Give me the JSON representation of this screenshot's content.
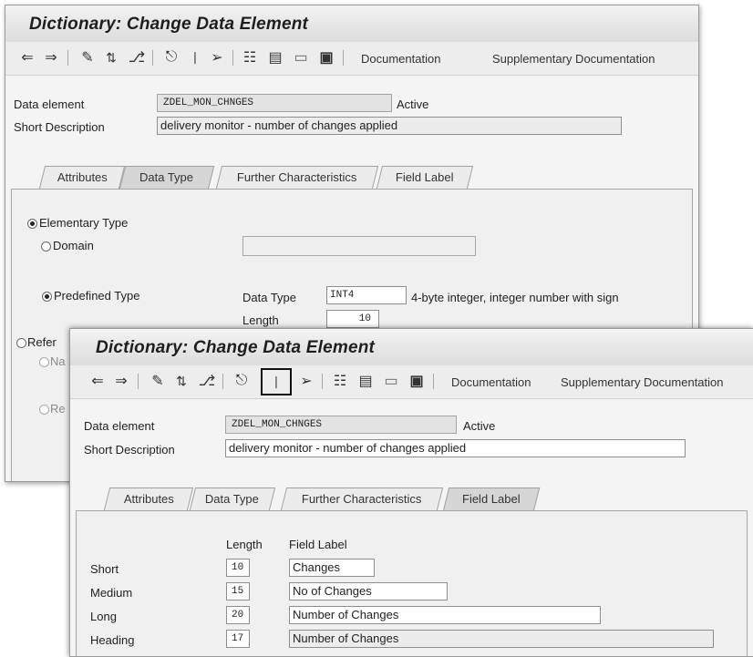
{
  "back_window": {
    "title": "Dictionary: Change Data Element",
    "toolbar": {
      "icons": [
        "back-arrow-icon",
        "forward-arrow-icon",
        "edit-pencil-icon",
        "toggle-display-change-icon",
        "other-object-icon",
        "where-used-icon",
        "check-icon",
        "activate-icon",
        "hierarchy-icon",
        "display-object-list-icon",
        "frame-icon",
        "info-icon"
      ],
      "documentation": "Documentation",
      "supplementary_documentation": "Supplementary Documentation"
    },
    "data_element_label": "Data element",
    "data_element_value": "ZDEL_MON_CHNGES",
    "status": "Active",
    "short_description_label": "Short Description",
    "short_description_value": "delivery monitor - number of changes applied",
    "tabs": [
      "Attributes",
      "Data Type",
      "Further Characteristics",
      "Field Label"
    ],
    "active_tab": "Data Type",
    "data_type_panel": {
      "elementary_type": "Elementary Type",
      "domain": "Domain",
      "predefined_type": "Predefined Type",
      "data_type_label": "Data Type",
      "data_type_value": "INT4",
      "data_type_description": "4-byte integer, integer number with sign",
      "length_label": "Length",
      "length_value": "10",
      "reference_type_partial": "Refer",
      "name_partial": "Na",
      "reference_partial": "Re"
    }
  },
  "front_window": {
    "title": "Dictionary: Change Data Element",
    "toolbar": {
      "documentation": "Documentation",
      "supplementary_documentation": "Supplementary Documentation"
    },
    "data_element_label": "Data element",
    "data_element_value": "ZDEL_MON_CHNGES",
    "status": "Active",
    "short_description_label": "Short Description",
    "short_description_value": "delivery monitor - number of changes applied",
    "tabs": [
      "Attributes",
      "Data Type",
      "Further Characteristics",
      "Field Label"
    ],
    "active_tab": "Field Label",
    "field_label_panel": {
      "length_header": "Length",
      "field_label_header": "Field Label",
      "rows": [
        {
          "name": "Short",
          "length": "10",
          "label": "Changes"
        },
        {
          "name": "Medium",
          "length": "15",
          "label": "No of Changes"
        },
        {
          "name": "Long",
          "length": "20",
          "label": "Number of  Changes"
        },
        {
          "name": "Heading",
          "length": "17",
          "label": "Number of Changes"
        }
      ]
    }
  },
  "colors": {
    "active_tab": "#d6d6d6",
    "panel": "#f0f0f0",
    "readonly_field": "#e3e3e3"
  }
}
